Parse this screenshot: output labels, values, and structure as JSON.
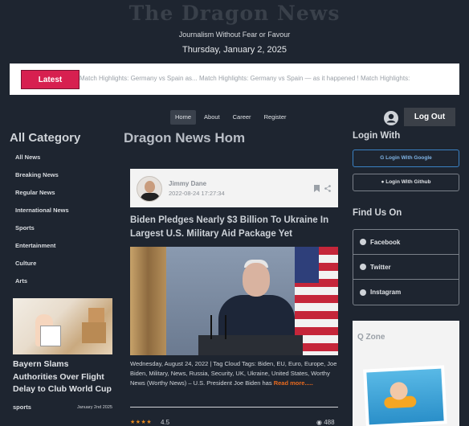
{
  "header": {
    "logo": "The Dragon News",
    "tagline": "Journalism Without Fear or Favour",
    "date": "Thursday, January 2, 2025"
  },
  "ticker": {
    "label": "Latest",
    "text": "Match Highlights: Germany vs Spain as...     Match Highlights: Germany vs Spain — as it happened ! Match Highlights:"
  },
  "nav": {
    "items": [
      "Home",
      "About",
      "Career",
      "Register"
    ],
    "active": "Home",
    "logout": "Log Out"
  },
  "categories": {
    "title": "All Category",
    "items": [
      "All News",
      "Breaking News",
      "Regular News",
      "International News",
      "Sports",
      "Entertainment",
      "Culture",
      "Arts"
    ]
  },
  "side_card": {
    "title": "Bayern Slams Authorities Over Flight Delay to Club World Cup",
    "tag": "sports",
    "date": "January 2nd 2025"
  },
  "main": {
    "title": "Dragon News Hom",
    "article": {
      "author": "Jimmy Dane",
      "published": "2022-08-24 17:27:34",
      "headline": "Biden Pledges Nearly $3 Billion To Ukraine In Largest U.S. Military Aid Package Yet",
      "excerpt": "Wednesday, August 24, 2022 | Tag Cloud Tags: Biden, EU, Euro, Europe, Joe Biden, Military, News, Russia, Security, UK, Ukraine, United States, Worthy News (Worthy News) – U.S. President Joe Biden has",
      "read_more": "Read more.....",
      "stars": "★★★★",
      "rating": "4.5",
      "views": "488"
    }
  },
  "sidebar_right": {
    "login_title": "Login With",
    "google": "Login With Google",
    "github": "Login With Github",
    "find_title": "Find Us On",
    "social": [
      "Facebook",
      "Twitter",
      "Instagram"
    ],
    "qzone_title": "Q Zone"
  },
  "colors": {
    "background": "#1e2530",
    "accent": "#d72050",
    "link": "#e96a1e"
  }
}
